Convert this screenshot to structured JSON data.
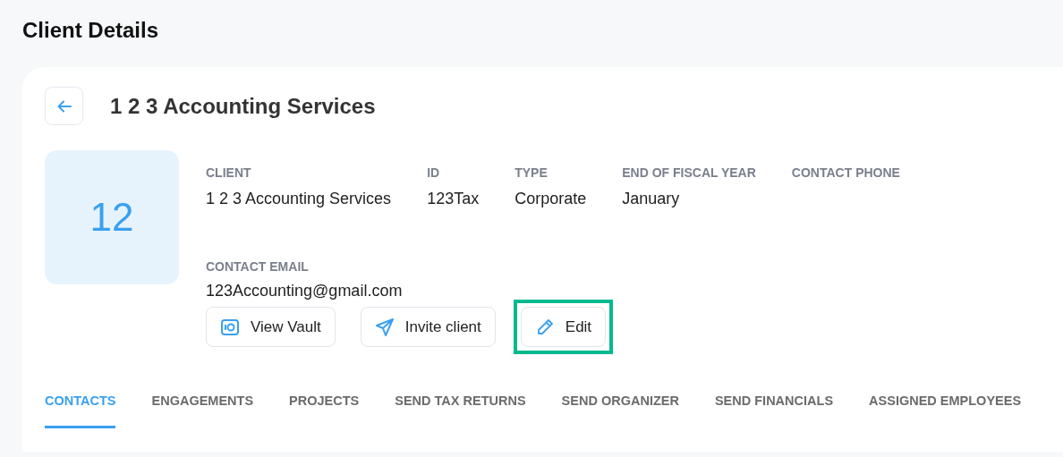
{
  "page_title": "Client Details",
  "client_name": "1 2 3 Accounting Services",
  "avatar": "12",
  "fields": [
    {
      "label": "CLIENT",
      "value": "1 2 3 Accounting Services"
    },
    {
      "label": "ID",
      "value": "123Tax"
    },
    {
      "label": "TYPE",
      "value": "Corporate"
    },
    {
      "label": "END OF FISCAL YEAR",
      "value": "January"
    },
    {
      "label": "CONTACT PHONE"
    }
  ],
  "email_field": {
    "label": "CONTACT EMAIL",
    "value": "123Accounting@gmail.com"
  },
  "actions": [
    {
      "kind": "vault",
      "label": "View Vault",
      "highlighted": false
    },
    {
      "kind": "invite",
      "label": "Invite client",
      "highlighted": false
    },
    {
      "kind": "edit",
      "label": "Edit",
      "highlighted": true
    }
  ],
  "tabs": [
    {
      "label": "CONTACTS",
      "selected": true
    },
    {
      "label": "ENGAGEMENTS",
      "selected": false
    },
    {
      "label": "PROJECTS",
      "selected": false
    },
    {
      "label": "SEND TAX RETURNS",
      "selected": false
    },
    {
      "label": "SEND ORGANIZER",
      "selected": false
    },
    {
      "label": "SEND FINANCIALS",
      "selected": false
    },
    {
      "label": "ASSIGNED EMPLOYEES",
      "selected": false
    }
  ]
}
